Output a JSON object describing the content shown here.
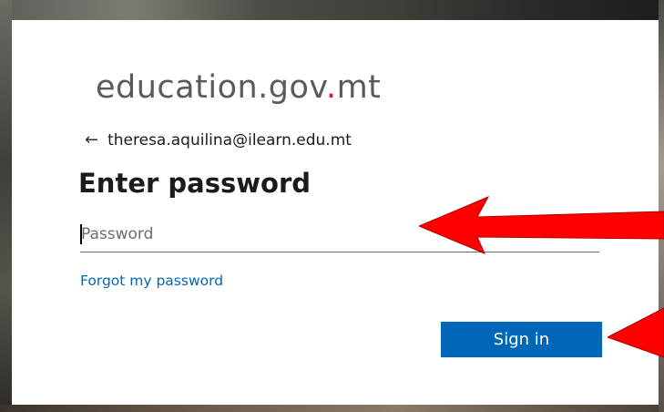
{
  "brand": {
    "logo_prefix": "education.gov",
    "logo_dot": ".",
    "logo_suffix": "mt",
    "dot_color": "#c8203a"
  },
  "identity": {
    "back_icon": "arrow-left-icon",
    "email": "theresa.aquilina@ilearn.edu.mt"
  },
  "form": {
    "title": "Enter password",
    "password_placeholder": "Password",
    "password_value": "",
    "forgot_link": "Forgot my password",
    "signin_label": "Sign in"
  },
  "annotations": {
    "arrow_color": "#ff0000",
    "arrows": [
      "arrow-to-password-field",
      "arrow-to-signin-button"
    ]
  },
  "colors": {
    "accent": "#0067b8",
    "text": "#1b1b1b"
  }
}
